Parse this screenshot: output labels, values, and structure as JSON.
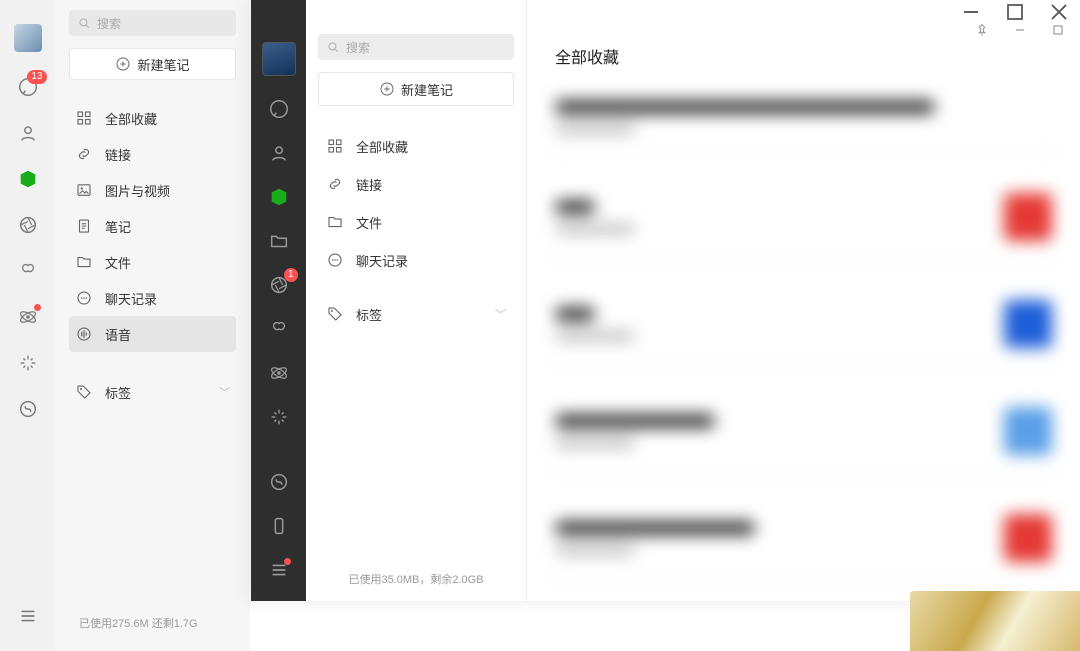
{
  "bg": {
    "search_placeholder": "搜索",
    "new_note": "新建笔记",
    "rail_badge": "13",
    "categories": [
      {
        "key": "all",
        "label": "全部收藏"
      },
      {
        "key": "link",
        "label": "链接"
      },
      {
        "key": "media",
        "label": "图片与视频"
      },
      {
        "key": "note",
        "label": "笔记"
      },
      {
        "key": "file",
        "label": "文件"
      },
      {
        "key": "chatlog",
        "label": "聊天记录"
      },
      {
        "key": "audio",
        "label": "语音"
      }
    ],
    "tags_label": "标签",
    "storage": "已使用275.6M 还剩1.7G"
  },
  "fg": {
    "search_placeholder": "搜索",
    "new_note": "新建笔记",
    "rail_badge": "1",
    "categories": [
      {
        "key": "all",
        "label": "全部收藏"
      },
      {
        "key": "link",
        "label": "链接"
      },
      {
        "key": "file",
        "label": "文件"
      },
      {
        "key": "chatlog",
        "label": "聊天记录"
      }
    ],
    "tags_label": "标签",
    "storage": "已使用35.0MB，剩余2.0GB",
    "main_title": "全部收藏"
  }
}
